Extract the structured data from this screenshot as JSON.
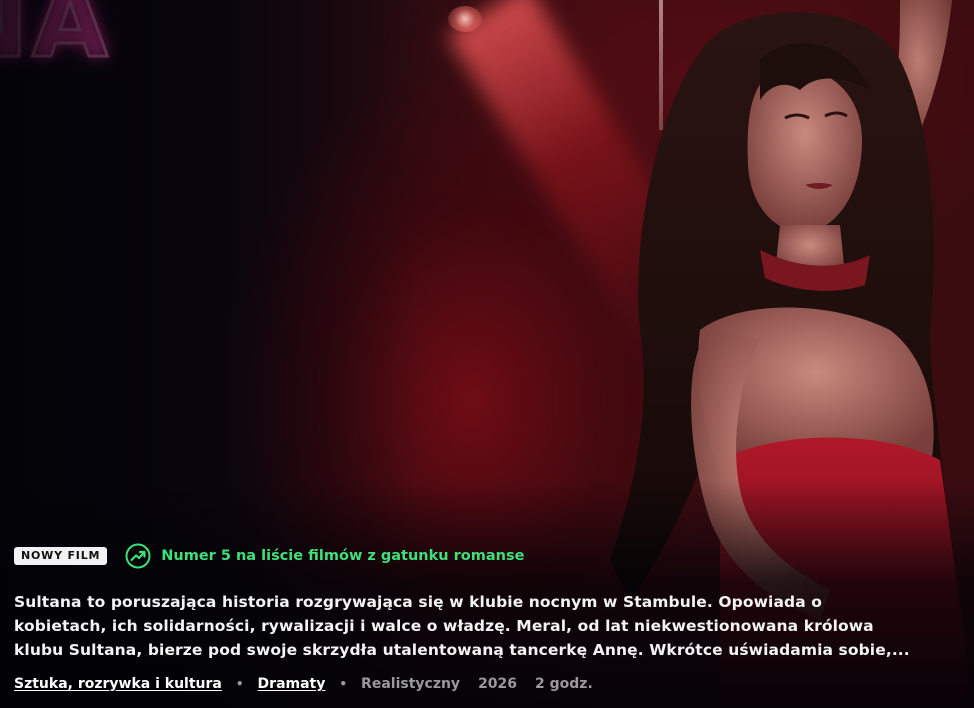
{
  "hero": {
    "title_fragment": "NA",
    "accent_colors": {
      "neon": "#ff7cc8",
      "trend": "#3fe07a",
      "background_red": "#7d0c16"
    }
  },
  "badge": {
    "label": "NOWY FILM"
  },
  "trending": {
    "icon": "trending-up-icon",
    "text": "Numer 5 na liście filmów z gatunku romanse"
  },
  "synopsis": {
    "line1": "Sultana to poruszająca historia rozgrywająca się w klubie nocnym w Stambule. Opowiada o",
    "line2": "kobietach, ich solidarności, rywalizacji i walce o władzę. Meral, od lat niekwestionowana królowa",
    "line3": "klubu Sultana, bierze pod swoje skrzydła utalentowaną tancerkę Annę. Wkrótce uświadamia sobie,..."
  },
  "meta": {
    "genre1": "Sztuka, rozrywka i kultura",
    "genre2": "Dramaty",
    "tone": "Realistyczny",
    "year": "2026",
    "duration": "2 godz."
  }
}
